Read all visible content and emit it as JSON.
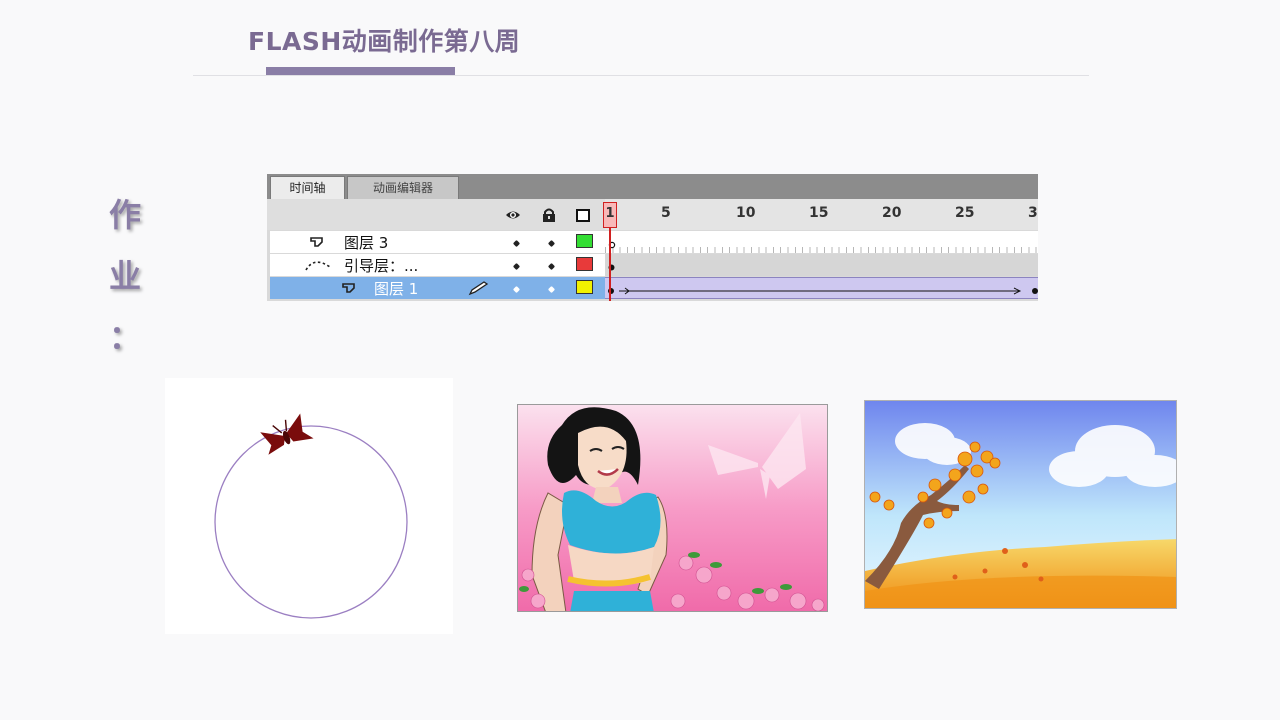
{
  "slide": {
    "title": "FLASH动画制作第八周",
    "side_label": [
      "作",
      "业",
      "："
    ]
  },
  "timeline": {
    "tabs": [
      {
        "label": "时间轴",
        "active": true
      },
      {
        "label": "动画编辑器",
        "active": false
      }
    ],
    "header_icons": [
      "eye-icon",
      "lock-icon",
      "outline-icon"
    ],
    "current_frame": "1",
    "frame_numbers": [
      "5",
      "10",
      "15",
      "20",
      "25",
      "3"
    ],
    "layers": [
      {
        "name": "图层 3",
        "icon": "layer-icon",
        "color": "#33dd33",
        "selected": false
      },
      {
        "name": "引导层：...",
        "icon": "guide-layer-icon",
        "color": "#e83a3a",
        "selected": false
      },
      {
        "name": "图层 1",
        "icon": "layer-icon",
        "color": "#f2f200",
        "selected": true
      }
    ]
  },
  "images": [
    {
      "name": "motion-guide-circle-with-butterfly"
    },
    {
      "name": "girl-with-butterfly-pink-background"
    },
    {
      "name": "autumn-tree-landscape"
    }
  ]
}
